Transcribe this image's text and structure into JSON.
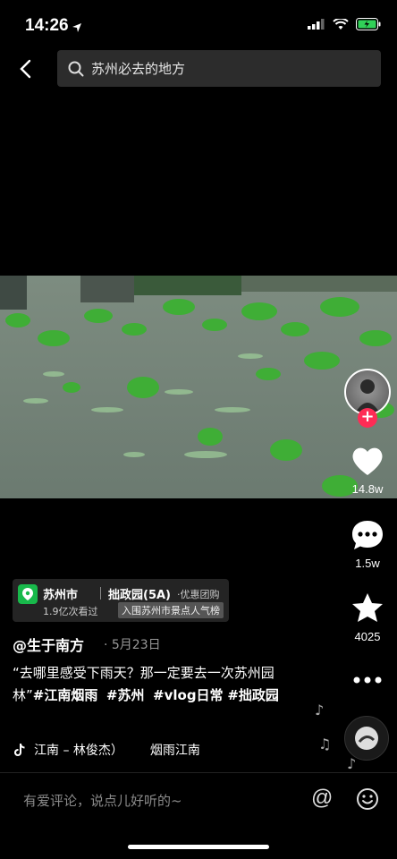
{
  "status_bar": {
    "time": "14:26"
  },
  "search": {
    "query": "苏州必去的地方"
  },
  "rail": {
    "likes": "14.8w",
    "comments": "1.5w",
    "favorites": "4025"
  },
  "location": {
    "city": "苏州市",
    "place": "拙政园(5A)",
    "deal": "·优惠团购",
    "views": "1.9亿次看过",
    "rank": "入围苏州市景点人气榜"
  },
  "post": {
    "author": "@生于南方",
    "date": "· 5月23日",
    "caption_text": "“去哪里感受下雨天？那一定要去一次苏州园林”",
    "tags": [
      "#江南烟雨",
      "#苏州",
      "#vlog日常",
      "#拙政园"
    ]
  },
  "music": {
    "line1": "江南 – 林俊杰）",
    "line2": "烟雨江南"
  },
  "comment_bar": {
    "placeholder": "有爱评论，说点儿好听的~",
    "at_symbol": "@"
  },
  "colors": {
    "accent": "#fe2c55",
    "location_green": "#18b94b"
  },
  "icons": [
    "back-icon",
    "search-icon",
    "heart-icon",
    "comment-icon",
    "star-icon",
    "more-icon",
    "music-note-icon",
    "emoji-icon"
  ]
}
